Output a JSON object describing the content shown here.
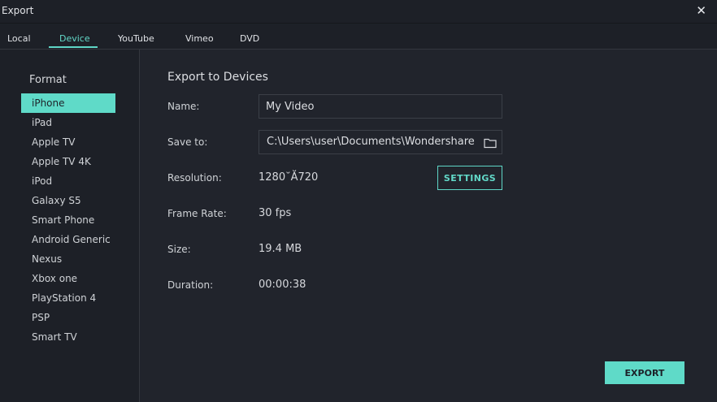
{
  "window": {
    "title": "Export",
    "close_icon": "close-icon"
  },
  "tabs": [
    {
      "label": "Local"
    },
    {
      "label": "Device"
    },
    {
      "label": "YouTube"
    },
    {
      "label": "Vimeo"
    },
    {
      "label": "DVD"
    }
  ],
  "active_tab": "Device",
  "sidebar": {
    "format_label": "Format",
    "devices": [
      {
        "label": "iPhone"
      },
      {
        "label": "iPad"
      },
      {
        "label": "Apple TV"
      },
      {
        "label": "Apple TV 4K"
      },
      {
        "label": "iPod"
      },
      {
        "label": "Galaxy S5"
      },
      {
        "label": "Smart Phone"
      },
      {
        "label": "Android Generic"
      },
      {
        "label": "Nexus"
      },
      {
        "label": "Xbox one"
      },
      {
        "label": "PlayStation 4"
      },
      {
        "label": "PSP"
      },
      {
        "label": "Smart TV"
      }
    ],
    "selected": "iPhone"
  },
  "main": {
    "heading": "Export to Devices",
    "name_label": "Name:",
    "name_value": "My Video",
    "save_label": "Save to:",
    "save_value": "C:\\Users\\user\\Documents\\Wondershare Filmora",
    "resolution_label": "Resolution:",
    "resolution_value": "1280˘Ă720",
    "settings_label": "SETTINGS",
    "framerate_label": "Frame Rate:",
    "framerate_value": "30 fps",
    "size_label": "Size:",
    "size_value": "19.4 MB",
    "duration_label": "Duration:",
    "duration_value": "00:00:38",
    "export_label": "EXPORT"
  },
  "colors": {
    "accent": "#5fdac8",
    "background": "#21242c",
    "panel": "#1d2027"
  }
}
